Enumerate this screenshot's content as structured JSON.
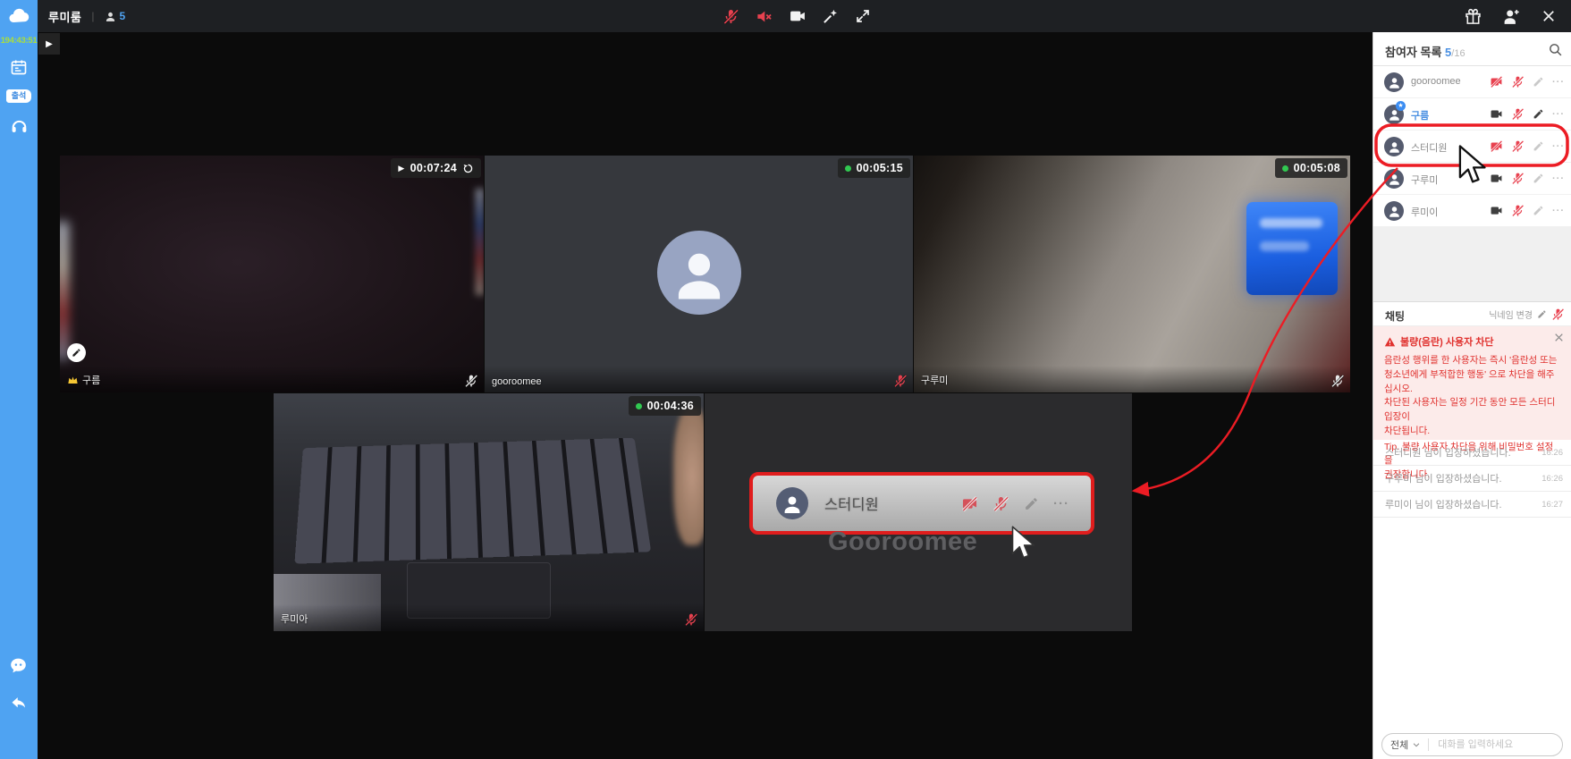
{
  "colors": {
    "sidebar_blue": "#4fa3f2",
    "accent_blue": "#4a90e2",
    "danger_red": "#e8414f",
    "annotation_red": "#ec1c24",
    "timer_green": "#aade3c",
    "live_dot_green": "#31c851"
  },
  "topbar": {
    "room_title": "루미룸",
    "participant_count": "5"
  },
  "sidebar": {
    "session_timer": "194:43:51",
    "attendance_label": "출석",
    "expand_glyph": "▶"
  },
  "tiles": [
    {
      "name": "구름",
      "timer": "00:07:24"
    },
    {
      "name": "gooroomee",
      "timer": "00:05:15"
    },
    {
      "name": "구루미",
      "timer": "00:05:08"
    },
    {
      "name": "루미아",
      "timer": "00:04:36"
    }
  ],
  "overlay": {
    "name": "스터디원",
    "watermark": "Gooroomee",
    "dots": "···"
  },
  "panel": {
    "title": "참여자 목록",
    "count": "5",
    "count_max": "/16",
    "rows": [
      {
        "name": "gooroomee",
        "dots": "···"
      },
      {
        "name": "구름",
        "dots": "···",
        "badge": "★"
      },
      {
        "name": "스터디원",
        "dots": "···"
      },
      {
        "name": "구루미",
        "dots": "···"
      },
      {
        "name": "루미이",
        "dots": "···"
      }
    ]
  },
  "chat": {
    "title": "채팅",
    "nickname_change": "닉네임 변경",
    "warning": {
      "title": "불량(음란) 사용자 차단",
      "body": "음란성 행위를 한 사용자는 즉시 '음란성 또는\n청소년에게 부적합한 행동' 으로 차단을 해주십시오.\n차단된 사용자는 일정 기간 동안 모든 스터디 입장이\n차단됩니다.",
      "tip": "Tip. 불량 사용자 차단을 위해 비밀번호 설정을\n권장합니다."
    },
    "messages": [
      {
        "text": "스터디원 님이 입장하셨습니다.",
        "time": "16:26"
      },
      {
        "text": "구루미 님이 입장하셨습니다.",
        "time": "16:26"
      },
      {
        "text": "루미이 님이 입장하셨습니다.",
        "time": "16:27"
      }
    ],
    "scope": "전체",
    "input_placeholder": "대화를 입력하세요"
  }
}
